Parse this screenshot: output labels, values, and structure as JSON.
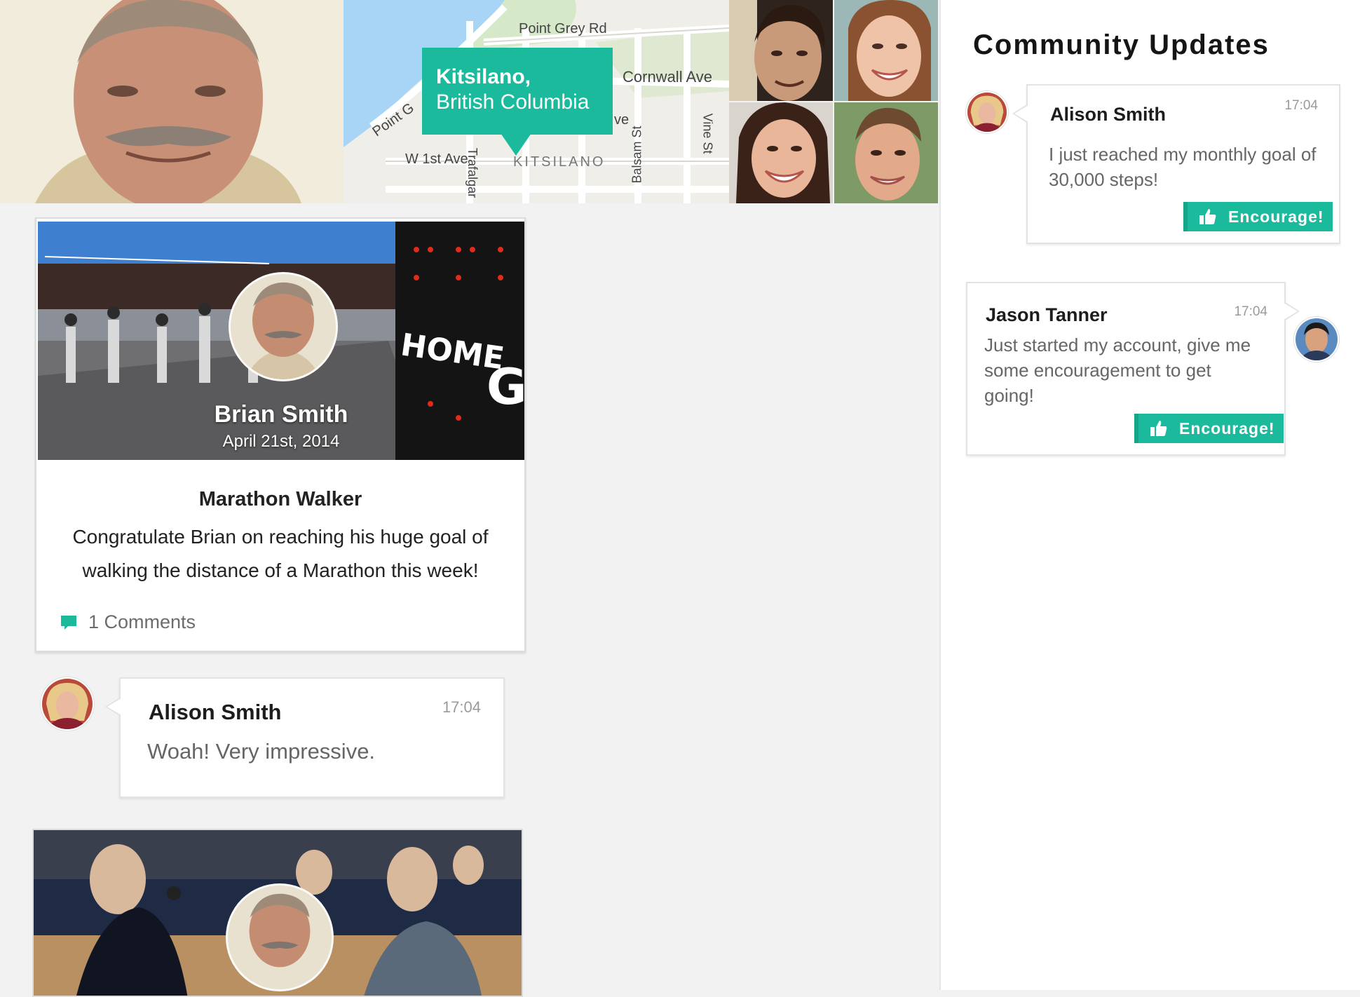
{
  "header": {
    "map": {
      "pin_title": "Kitsilano,",
      "pin_subtitle": "British Columbia",
      "streets": [
        "Point Grey Rd",
        "Cornwall Ave",
        "Point G",
        "W 1st Ave",
        "Trafalgar",
        "KITSILANO",
        "Balsam St",
        "Vine St",
        "ve"
      ]
    }
  },
  "feed": {
    "post": {
      "author": "Brian Smith",
      "date": "April 21st, 2014",
      "title": "Marathon Walker",
      "body": "Congratulate Brian on reaching his huge goal of walking the distance of a Marathon this week!",
      "comments_label": "1 Comments",
      "comment_icon": "speech-bubble-icon"
    },
    "comment": {
      "name": "Alison Smith",
      "time": "17:04",
      "text": "Woah! Very impressive."
    }
  },
  "sidebar": {
    "title": "Community Updates",
    "updates": [
      {
        "name": "Alison Smith",
        "time": "17:04",
        "text": "I just reached my monthly goal of 30,000 steps!",
        "button": "Encourage!"
      },
      {
        "name": "Jason Tanner",
        "time": "17:04",
        "text": "Just started my account, give me some encouragement to get going!",
        "button": "Encourage!"
      }
    ],
    "button_icon": "thumbs-up-icon"
  },
  "colors": {
    "accent": "#1cba9d",
    "background": "#f2f2f2",
    "card": "#ffffff"
  }
}
